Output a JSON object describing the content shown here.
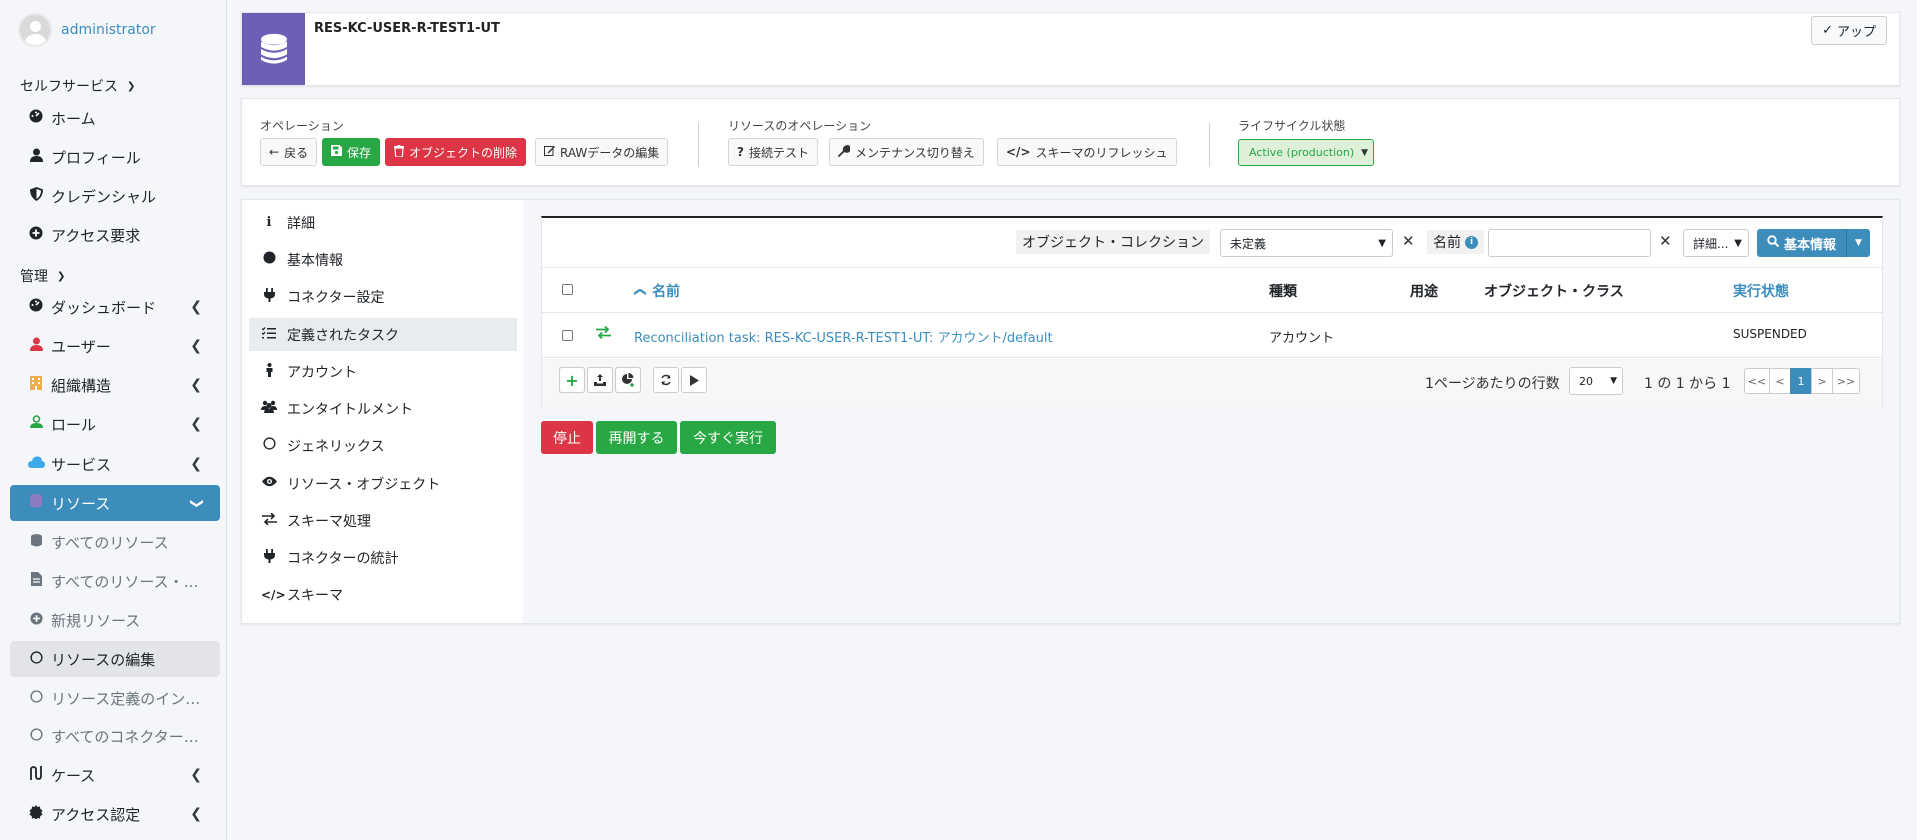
{
  "user": {
    "name": "administrator"
  },
  "sidebar": {
    "selfservice_header": "セルフサービス",
    "admin_header": "管理",
    "selfservice_items": [
      {
        "label": "ホーム",
        "icon": "dashboard-icon"
      },
      {
        "label": "プロフィール",
        "icon": "user-icon"
      },
      {
        "label": "クレデンシャル",
        "icon": "shield-icon"
      },
      {
        "label": "アクセス要求",
        "icon": "plus-circle-icon"
      }
    ],
    "admin_items": [
      {
        "label": "ダッシュボード",
        "icon": "dashboard-icon"
      },
      {
        "label": "ユーザー",
        "icon": "user-icon",
        "color": "#dc3545"
      },
      {
        "label": "組織構造",
        "icon": "building-icon",
        "color": "#f0ad4e"
      },
      {
        "label": "ロール",
        "icon": "role-icon",
        "color": "#28a745"
      },
      {
        "label": "サービス",
        "icon": "cloud-icon",
        "color": "#3ca9e8"
      },
      {
        "label": "リソース",
        "icon": "database-icon",
        "color": "#8e7cc3"
      }
    ],
    "resource_sub_items": [
      {
        "label": "すべてのリソース",
        "icon": "database-icon"
      },
      {
        "label": "すべてのリソース・…",
        "icon": "file-icon"
      },
      {
        "label": "新規リソース",
        "icon": "plus-circle-icon"
      },
      {
        "label": "リソースの編集",
        "icon": "circle-icon"
      },
      {
        "label": "リソース定義のイン…",
        "icon": "circle-icon"
      },
      {
        "label": "すべてのコネクター…",
        "icon": "circle-icon"
      }
    ],
    "tail_items": [
      {
        "label": "ケース",
        "icon": "case-icon"
      },
      {
        "label": "アクセス認定",
        "icon": "cert-icon"
      }
    ]
  },
  "header": {
    "resource_name": "RES-KC-USER-R-TEST1-UT",
    "up_label": "アップ"
  },
  "operations": {
    "label": "オペレーション",
    "back": "戻る",
    "save": "保存",
    "delete": "オブジェクトの削除",
    "edit_raw": "RAWデータの編集"
  },
  "resource_operations": {
    "label": "リソースのオペレーション",
    "test_connection": "接続テスト",
    "maintenance": "メンテナンス切り替え",
    "refresh_schema": "スキーマのリフレッシュ"
  },
  "lifecycle": {
    "label": "ライフサイクル状態",
    "value": "Active (production)"
  },
  "details_nav": [
    {
      "label": "詳細",
      "icon": "info-icon"
    },
    {
      "label": "基本情報",
      "icon": "circle-filled-icon"
    },
    {
      "label": "コネクター設定",
      "icon": "plug-icon"
    },
    {
      "label": "定義されたタスク",
      "icon": "tasks-icon"
    },
    {
      "label": "アカウント",
      "icon": "person-icon"
    },
    {
      "label": "エンタイトルメント",
      "icon": "users-icon"
    },
    {
      "label": "ジェネリックス",
      "icon": "circle-icon"
    },
    {
      "label": "リソース・オブジェクト",
      "icon": "eye-icon"
    },
    {
      "label": "スキーマ処理",
      "icon": "exchange-icon"
    },
    {
      "label": "コネクターの統計",
      "icon": "plug-icon"
    },
    {
      "label": "スキーマ",
      "icon": "code-icon"
    }
  ],
  "filter": {
    "collection_label": "オブジェクト・コレクション",
    "collection_value": "未定義",
    "name_label": "名前",
    "name_value": "",
    "details_label": "詳細...",
    "basic_label": "基本情報"
  },
  "table": {
    "headers": {
      "name": "名前",
      "kind": "種類",
      "usage": "用途",
      "object_class": "オブジェクト・クラス",
      "exec_state": "実行状態"
    },
    "rows": [
      {
        "name": "Reconciliation task: RES-KC-USER-R-TEST1-UT: アカウント/default",
        "kind": "アカウント",
        "usage": "",
        "object_class": "",
        "exec_state": "SUSPENDED"
      }
    ]
  },
  "pagination": {
    "rows_per_page_label": "1ページあたりの行数",
    "rows_per_page": "20",
    "range": "1 の 1 から 1",
    "first": "<<",
    "prev": "<",
    "current": "1",
    "next": ">",
    "last": ">>"
  },
  "actions": {
    "stop": "停止",
    "resume": "再開する",
    "run_now": "今すぐ実行"
  }
}
